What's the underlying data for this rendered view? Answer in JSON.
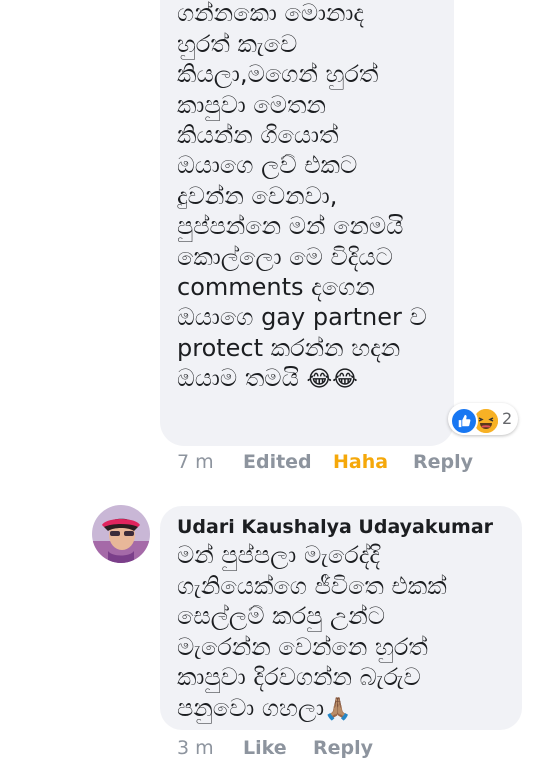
{
  "comment1": {
    "text": "උත්තර බදිද්දි දැන\nගන්නකො මොනාද\nහුරත් කැවෙ\nකියලා,මගෙන් හුරත්\nකාපුවා මෙතන\nකියන්න ගියොත්\nඔයාගෙ ලව් එකට\nදුවන්න වෙනවා,\nපුප්පන්නෙ මන් නෙමයි\nකොල්ලො මෙ විදියට\ncomments දගෙන\nඔයාගෙ gay partner ව\nprotect කරන්න හදන\nඔයාම තමයි ",
    "emoji": "😂😂",
    "reactions": {
      "count": "2",
      "icons": [
        "like-icon",
        "haha-icon"
      ]
    },
    "meta": {
      "time": "7 m",
      "edited": "Edited",
      "reaction_label": "Haha",
      "reply": "Reply"
    }
  },
  "comment2": {
    "author": "Udari Kaushalya Udayakumar",
    "text": "මන් පුප්පලා මැරෙද්දි\nගැනියෙක්ගෙ ජීවිතෙ එකක්\nසෙල්ලම් කරපු උන්ට\nමැරෙන්න වෙන්නෙ හුරත්\nකාපුවා දිරවගන්න බැරුව\nපනුවො ගහලා",
    "emoji": "🙏🏽",
    "meta": {
      "time": "3 m",
      "like": "Like",
      "reply": "Reply"
    }
  },
  "colors": {
    "bubble": "#f1f2f6",
    "haha": "#f5a80a",
    "meta": "#8d949e",
    "like_blue": "#1877f2"
  }
}
